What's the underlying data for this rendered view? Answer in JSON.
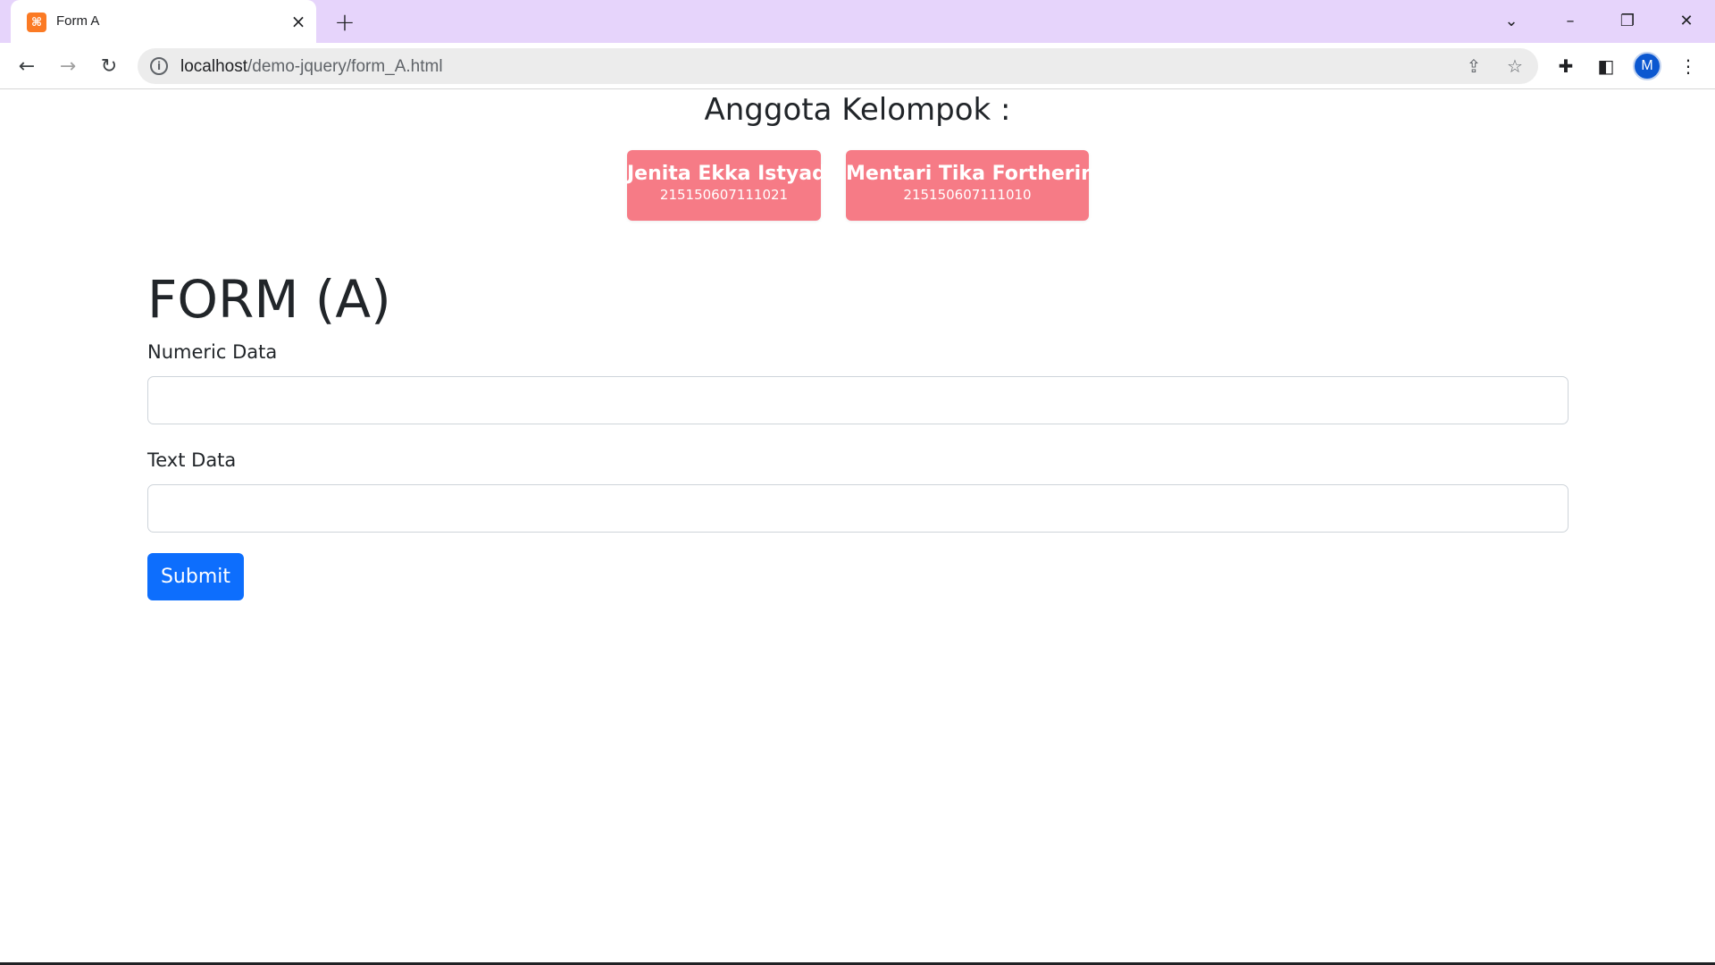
{
  "browser": {
    "tab_title": "Form A",
    "tab_close_icon": "×",
    "new_tab_icon": "+",
    "url_host": "localhost",
    "url_path": "/demo-jquery/form_A.html",
    "profile_initial": "M"
  },
  "page": {
    "group_title": "Anggota Kelompok :",
    "members": [
      {
        "name": "Jenita Ekka Istyadi",
        "id": "215150607111021"
      },
      {
        "name": "Mentari Tika Fortherina",
        "id": "215150607111010"
      }
    ],
    "form_title": "FORM (A)",
    "fields": [
      {
        "label": "Numeric Data",
        "value": ""
      },
      {
        "label": "Text Data",
        "value": ""
      }
    ],
    "submit_label": "Submit"
  },
  "colors": {
    "tab_strip": "#e6d4fb",
    "member_card": "#f67b86",
    "primary_button": "#0d6efd"
  }
}
